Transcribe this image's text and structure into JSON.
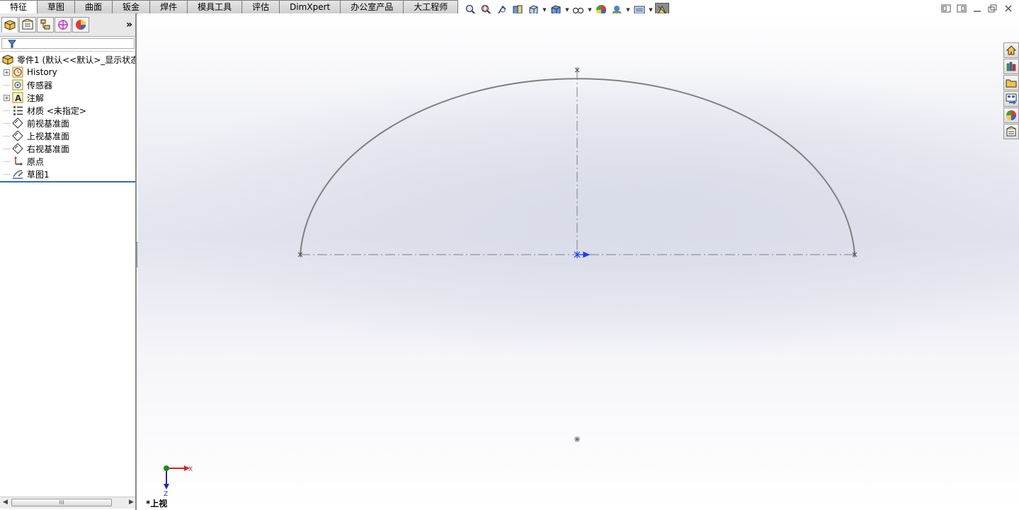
{
  "command_tabs": [
    "特征",
    "草图",
    "曲面",
    "钣金",
    "焊件",
    "模具工具",
    "评估",
    "DimXpert",
    "办公室产品",
    "大工程师"
  ],
  "active_tab_index": 0,
  "view_toolbar": {
    "icons": [
      "zoom-to-fit-icon",
      "zoom-area-icon",
      "previous-view-icon",
      "section-view-icon",
      "view-orientation-icon",
      "display-style-icon",
      "hide-show-items-icon",
      "edit-appearance-icon",
      "apply-scene-icon",
      "view-settings-icon",
      "sketch-tool-icon"
    ]
  },
  "panel_tabs": [
    "feature-manager-icon",
    "property-manager-icon",
    "configuration-manager-icon",
    "dimxpert-manager-icon",
    "display-manager-icon"
  ],
  "panel_more": "»",
  "tree": {
    "root": "零件1  (默认<<默认>_显示状态",
    "items": [
      {
        "label": "History",
        "icon": "history-icon",
        "expandable": true
      },
      {
        "label": "传感器",
        "icon": "sensor-icon",
        "expandable": false
      },
      {
        "label": "注解",
        "icon": "annotation-icon",
        "expandable": true
      },
      {
        "label": "材质 <未指定>",
        "icon": "material-icon",
        "expandable": false
      },
      {
        "label": "前视基准面",
        "icon": "plane-icon",
        "expandable": false
      },
      {
        "label": "上视基准面",
        "icon": "plane-icon",
        "expandable": false
      },
      {
        "label": "右视基准面",
        "icon": "plane-icon",
        "expandable": false
      },
      {
        "label": "原点",
        "icon": "origin-icon",
        "expandable": false
      },
      {
        "label": "草图1",
        "icon": "sketch-icon",
        "expandable": false
      }
    ]
  },
  "scrollbar": {
    "thumb_label": "III"
  },
  "viewport": {
    "view_name": "*上视",
    "triad_x_label": "X",
    "triad_z_label": "Z"
  },
  "colors": {
    "sketch_line": "#808080",
    "origin_blue": "#1a3cff",
    "selection_blue": "#2f6fb5"
  }
}
